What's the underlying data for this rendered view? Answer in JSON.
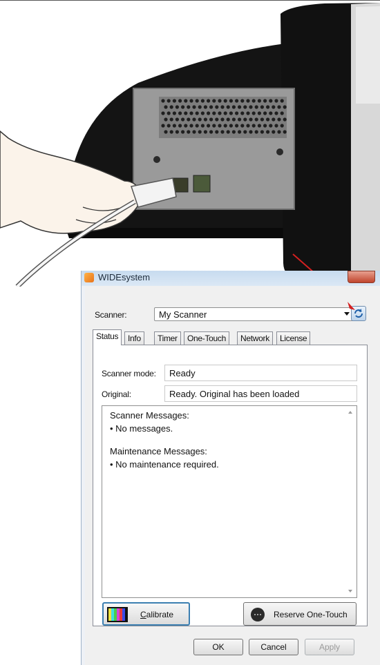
{
  "window": {
    "title": "WIDEsystem"
  },
  "scanner_row": {
    "label": "Scanner:",
    "value": "My Scanner"
  },
  "tabs": [
    {
      "label": "Status",
      "active": true
    },
    {
      "label": "Info",
      "active": false
    },
    {
      "label": "Timer",
      "active": false
    },
    {
      "label": "One-Touch",
      "active": false
    },
    {
      "label": "Network",
      "active": false
    },
    {
      "label": "License",
      "active": false
    }
  ],
  "status": {
    "mode_label": "Scanner mode:",
    "mode_value": "Ready",
    "original_label": "Original:",
    "original_value": "Ready. Original has been loaded",
    "scanner_messages_heading": "Scanner Messages:",
    "scanner_messages_item": "• No messages.",
    "maintenance_heading": "Maintenance Messages:",
    "maintenance_item": "• No maintenance required."
  },
  "buttons": {
    "calibrate_prefix": "",
    "calibrate_mnemonic": "C",
    "calibrate_rest": "alibrate",
    "reserve": "Reserve One-Touch",
    "ok": "OK",
    "cancel": "Cancel",
    "apply": "Apply"
  },
  "colors": {
    "annotation_arrow": "#d42020",
    "focus_border": "#3c7fb1"
  }
}
